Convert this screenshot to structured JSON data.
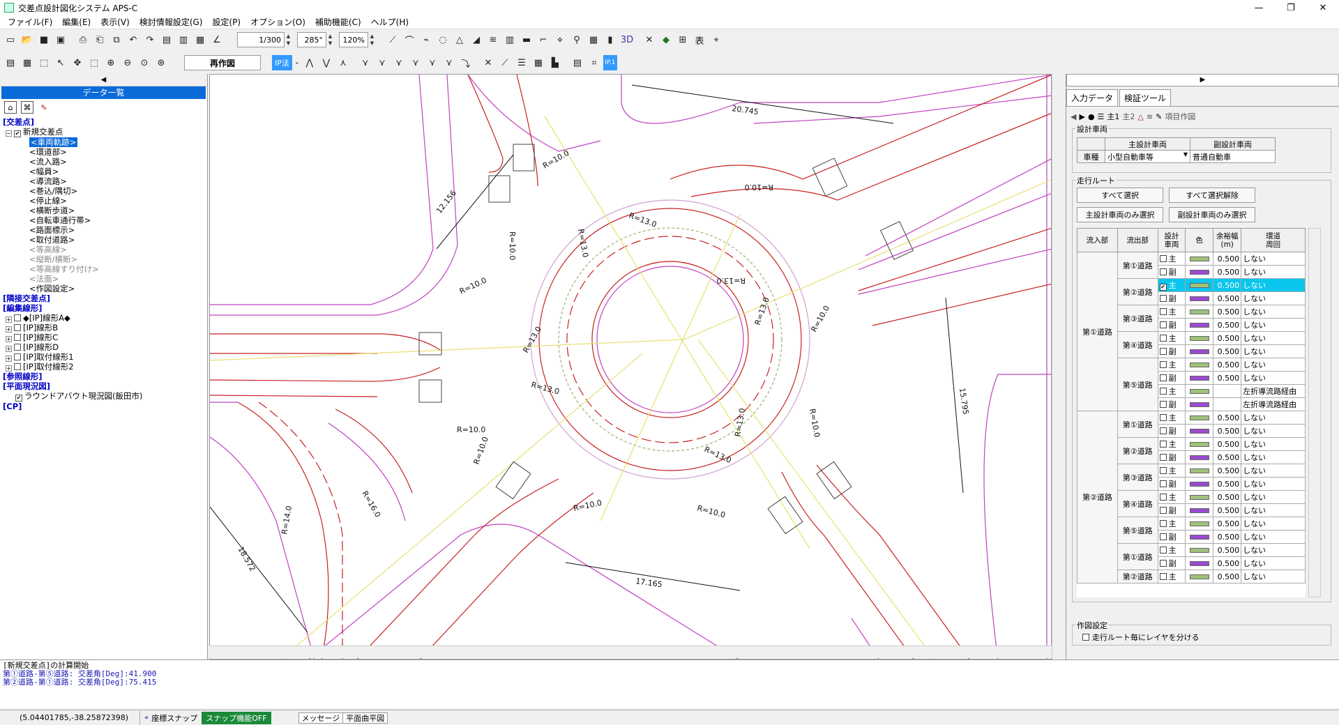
{
  "window": {
    "title": "交差点設計図化システム APS-C"
  },
  "menu": [
    "ファイル(F)",
    "編集(E)",
    "表示(V)",
    "検討情報設定(G)",
    "設定(P)",
    "オプション(O)",
    "補助機能(C)",
    "ヘルプ(H)"
  ],
  "toolbar": {
    "scale": "1/300",
    "angle": "285°",
    "zoom": "120%",
    "redraw_label": "再作図",
    "ip_label": "IP法",
    "ip1_label": "IP.1"
  },
  "left_panel": {
    "header": "データ一覧",
    "tree": [
      {
        "text": "[交差点]",
        "type": "sect"
      },
      {
        "text": "新規交差点",
        "type": "node",
        "check": "✔"
      },
      {
        "text": "<車両軌跡>",
        "type": "sel"
      },
      {
        "text": "<環道部>",
        "type": "item"
      },
      {
        "text": "<流入路>",
        "type": "item"
      },
      {
        "text": "<幅員>",
        "type": "item"
      },
      {
        "text": "<導流路>",
        "type": "item"
      },
      {
        "text": "<巻込/隅切>",
        "type": "item"
      },
      {
        "text": "<停止線>",
        "type": "item"
      },
      {
        "text": "<横断歩道>",
        "type": "item"
      },
      {
        "text": "<自転車通行帯>",
        "type": "item"
      },
      {
        "text": "<路面標示>",
        "type": "item"
      },
      {
        "text": "<取付道路>",
        "type": "item"
      },
      {
        "text": "<等高線>",
        "type": "gray"
      },
      {
        "text": "<縦断/横断>",
        "type": "gray"
      },
      {
        "text": "<等高線すり付け>",
        "type": "gray"
      },
      {
        "text": "<法面>",
        "type": "gray"
      },
      {
        "text": "<作図設定>",
        "type": "item"
      },
      {
        "text": "[隣接交差点]",
        "type": "sect"
      },
      {
        "text": "[編集線形]",
        "type": "sect"
      },
      {
        "text": "◆[IP]線形A◆",
        "type": "tree"
      },
      {
        "text": "[IP]線形B",
        "type": "tree"
      },
      {
        "text": "[IP]線形C",
        "type": "tree"
      },
      {
        "text": "[IP]線形D",
        "type": "tree"
      },
      {
        "text": "[IP]取付線形1",
        "type": "tree"
      },
      {
        "text": "[IP]取付線形2",
        "type": "tree"
      },
      {
        "text": "[参照線形]",
        "type": "sect"
      },
      {
        "text": "[平面現況図]",
        "type": "sect"
      },
      {
        "text": "ラウンドアバウト現況図(飯田市)",
        "type": "ref",
        "check": "✔"
      },
      {
        "text": "[CP]",
        "type": "sect"
      }
    ]
  },
  "drawing": {
    "dims": [
      "20.745",
      "12.156",
      "15.795",
      "18.572",
      "17.165"
    ],
    "radii": [
      "R=10.0",
      "R=10.0",
      "R=10.0",
      "R=13.0",
      "R=13.0",
      "R=13.0",
      "R=13.0",
      "R=13.0",
      "R=13.0",
      "R=13.0",
      "R=10.0",
      "R=10.0",
      "R=10.0",
      "R=10.0",
      "R=10.0",
      "R=16.0",
      "R=14.0",
      "R=10.0",
      "R=10.0",
      "R=13.0"
    ]
  },
  "right_panel": {
    "tabs": [
      "入力データ",
      "検証ツール"
    ],
    "tool_item_label": "項目作図",
    "design_vehicle": {
      "group_label": "設計車両",
      "col_main": "主設計車両",
      "col_sub": "副設計車両",
      "row_label": "車種",
      "main_value": "小型自動車等",
      "sub_value": "普通自動車"
    },
    "route": {
      "group_label": "走行ルート",
      "btn_select_all": "すべて選択",
      "btn_clear_all": "すべて選択解除",
      "btn_main_only": "主設計車両のみ選択",
      "btn_sub_only": "副設計車両のみ選択",
      "headers": [
        "流入部",
        "流出部",
        "設計\n車両",
        "色",
        "余裕幅\n(m)",
        "環道\n周回"
      ],
      "rows": [
        {
          "in": "第①道路",
          "out": "第①道路",
          "veh": "主",
          "color": "#9ec27a",
          "margin": "0.500",
          "loop": "しない",
          "checked": false,
          "hl": false
        },
        {
          "in": "",
          "out": "",
          "veh": "副",
          "color": "#9a4ad0",
          "margin": "0.500",
          "loop": "しない",
          "checked": false,
          "hl": false
        },
        {
          "in": "",
          "out": "第②道路",
          "veh": "主",
          "color": "#9ec27a",
          "margin": "0.500",
          "loop": "しない",
          "checked": true,
          "hl": true
        },
        {
          "in": "",
          "out": "",
          "veh": "副",
          "color": "#9a4ad0",
          "margin": "0.500",
          "loop": "しない",
          "checked": false,
          "hl": false
        },
        {
          "in": "",
          "out": "第③道路",
          "veh": "主",
          "color": "#9ec27a",
          "margin": "0.500",
          "loop": "しない",
          "checked": false,
          "hl": false
        },
        {
          "in": "",
          "out": "",
          "veh": "副",
          "color": "#9a4ad0",
          "margin": "0.500",
          "loop": "しない",
          "checked": false,
          "hl": false
        },
        {
          "in": "",
          "out": "第④道路",
          "veh": "主",
          "color": "#9ec27a",
          "margin": "0.500",
          "loop": "しない",
          "checked": false,
          "hl": false
        },
        {
          "in": "",
          "out": "",
          "veh": "副",
          "color": "#9a4ad0",
          "margin": "0.500",
          "loop": "しない",
          "checked": false,
          "hl": false
        },
        {
          "in": "",
          "out": "第⑤道路",
          "veh": "主",
          "color": "#9ec27a",
          "margin": "0.500",
          "loop": "しない",
          "checked": false,
          "hl": false
        },
        {
          "in": "",
          "out": "",
          "veh": "副",
          "color": "#9a4ad0",
          "margin": "0.500",
          "loop": "しない",
          "checked": false,
          "hl": false
        },
        {
          "in": "",
          "out": "",
          "veh": "主",
          "color": "#9ec27a",
          "margin": "",
          "loop": "左折導流路経由",
          "checked": false,
          "hl": false
        },
        {
          "in": "",
          "out": "",
          "veh": "副",
          "color": "#9a4ad0",
          "margin": "",
          "loop": "左折導流路経由",
          "checked": false,
          "hl": false
        },
        {
          "in": "第②道路",
          "out": "第①道路",
          "veh": "主",
          "color": "#9ec27a",
          "margin": "0.500",
          "loop": "しない",
          "checked": false,
          "hl": false
        },
        {
          "in": "",
          "out": "",
          "veh": "副",
          "color": "#9a4ad0",
          "margin": "0.500",
          "loop": "しない",
          "checked": false,
          "hl": false
        },
        {
          "in": "",
          "out": "第②道路",
          "veh": "主",
          "color": "#9ec27a",
          "margin": "0.500",
          "loop": "しない",
          "checked": false,
          "hl": false
        },
        {
          "in": "",
          "out": "",
          "veh": "副",
          "color": "#9a4ad0",
          "margin": "0.500",
          "loop": "しない",
          "checked": false,
          "hl": false
        },
        {
          "in": "",
          "out": "第③道路",
          "veh": "主",
          "color": "#9ec27a",
          "margin": "0.500",
          "loop": "しない",
          "checked": false,
          "hl": false
        },
        {
          "in": "",
          "out": "",
          "veh": "副",
          "color": "#9a4ad0",
          "margin": "0.500",
          "loop": "しない",
          "checked": false,
          "hl": false
        },
        {
          "in": "",
          "out": "第④道路",
          "veh": "主",
          "color": "#9ec27a",
          "margin": "0.500",
          "loop": "しない",
          "checked": false,
          "hl": false
        },
        {
          "in": "",
          "out": "",
          "veh": "副",
          "color": "#9a4ad0",
          "margin": "0.500",
          "loop": "しない",
          "checked": false,
          "hl": false
        },
        {
          "in": "",
          "out": "第⑤道路",
          "veh": "主",
          "color": "#9ec27a",
          "margin": "0.500",
          "loop": "しない",
          "checked": false,
          "hl": false
        },
        {
          "in": "",
          "out": "",
          "veh": "副",
          "color": "#9a4ad0",
          "margin": "0.500",
          "loop": "しない",
          "checked": false,
          "hl": false
        },
        {
          "in": "",
          "out": "第①道路",
          "veh": "主",
          "color": "#9ec27a",
          "margin": "0.500",
          "loop": "しない",
          "checked": false,
          "hl": false
        },
        {
          "in": "",
          "out": "",
          "veh": "副",
          "color": "#9a4ad0",
          "margin": "0.500",
          "loop": "しない",
          "checked": false,
          "hl": false
        },
        {
          "in": "",
          "out": "第②道路",
          "veh": "主",
          "color": "#9ec27a",
          "margin": "0.500",
          "loop": "しない",
          "checked": false,
          "hl": false
        }
      ]
    },
    "plot_settings": {
      "group_label": "作図設定",
      "checkbox_label": "走行ルート毎にレイヤを分ける"
    }
  },
  "messages": [
    "[新規交差点]の計算開始",
    "第①道路-第⑤道路: 交差角[Deg]:41.900",
    "第②道路-第①道路: 交差角[Deg]:75.415"
  ],
  "status": {
    "coord": "(5.04401785,-38.25872398)",
    "snap_label": "座標スナップ",
    "snap_off_label": "スナップ機能OFF",
    "tab_message": "メッセージ",
    "tab_plan": "平面曲平図"
  }
}
